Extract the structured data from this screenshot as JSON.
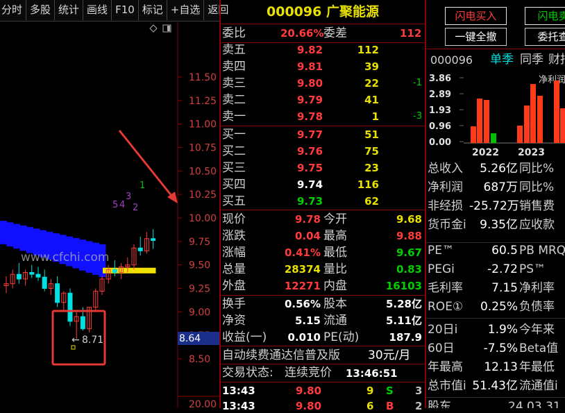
{
  "toolbar": {
    "items": [
      "分时",
      "多股",
      "统计",
      "画线",
      "F10",
      "标记",
      "+自选",
      "返回"
    ]
  },
  "chart": {
    "price_axis": [
      "11.50",
      "11.25",
      "11.00",
      "10.75",
      "10.50",
      "10.25",
      "10.00",
      "9.75",
      "9.50",
      "9.25",
      "9.00",
      "8.75",
      "8.50"
    ],
    "current_marker": "8.64",
    "bottom_axis": "20.00",
    "watermark": "www.cfchi.com",
    "low_label": "8.71",
    "wave_labels": [
      "5",
      "4",
      "3",
      "2",
      "1"
    ]
  },
  "quote": {
    "code": "000096",
    "name": "广聚能源",
    "committee_ratio_label": "委比",
    "committee_ratio": "20.66%",
    "committee_diff_label": "委差",
    "committee_diff": "112",
    "asks": [
      {
        "label": "卖五",
        "price": "9.82",
        "vol": "112",
        "chg": ""
      },
      {
        "label": "卖四",
        "price": "9.81",
        "vol": "39",
        "chg": ""
      },
      {
        "label": "卖三",
        "price": "9.80",
        "vol": "22",
        "chg": "-1"
      },
      {
        "label": "卖二",
        "price": "9.79",
        "vol": "41",
        "chg": ""
      },
      {
        "label": "卖一",
        "price": "9.78",
        "vol": "1",
        "chg": "-3"
      }
    ],
    "bids": [
      {
        "label": "买一",
        "price": "9.77",
        "vol": "51"
      },
      {
        "label": "买二",
        "price": "9.76",
        "vol": "75"
      },
      {
        "label": "买三",
        "price": "9.75",
        "vol": "23"
      },
      {
        "label": "买四",
        "price": "9.74",
        "vol": "116"
      },
      {
        "label": "买五",
        "price": "9.73",
        "vol": "62"
      }
    ],
    "stats": [
      {
        "l1": "现价",
        "v1": "9.78",
        "l2": "今开",
        "v2": "9.68"
      },
      {
        "l1": "涨跌",
        "v1": "0.04",
        "l2": "最高",
        "v2": "9.88"
      },
      {
        "l1": "涨幅",
        "v1": "0.41%",
        "l2": "最低",
        "v2": "9.67"
      },
      {
        "l1": "总量",
        "v1": "28374",
        "l2": "量比",
        "v2": "0.83"
      },
      {
        "l1": "外盘",
        "v1": "12271",
        "l2": "内盘",
        "v2": "16103"
      }
    ],
    "stats2": [
      {
        "l1": "换手",
        "v1": "0.56%",
        "l2": "股本",
        "v2": "5.28亿"
      },
      {
        "l1": "净资",
        "v1": "5.15",
        "l2": "流通",
        "v2": "5.11亿"
      },
      {
        "l1": "收益(一)",
        "v1": "0.010",
        "l2": "PE(动)",
        "v2": "187.9"
      }
    ],
    "ad_text": "自动续费通达信普及版",
    "ad_price": "30元/月",
    "trade_status_label": "交易状态:",
    "trade_status": "连续竞价",
    "trade_time": "13:46:51",
    "ticks": [
      {
        "time": "13:43",
        "price": "9.80",
        "vol": "9",
        "side": "S",
        "n": "3"
      },
      {
        "time": "13:43",
        "price": "9.80",
        "vol": "6",
        "side": "B",
        "n": "2"
      }
    ]
  },
  "side": {
    "flash_buy": "闪电买入",
    "flash_sell": "闪电卖",
    "cancel_all": "一键全撤",
    "entrust_query": "委托查",
    "code": "000096",
    "tab_single": "单季",
    "tab_yoy": "同季",
    "tab_finance": "财报",
    "chart_title": "净利润",
    "y_ticks": [
      "3.86",
      "2.89",
      "1.93",
      "0.96",
      "0.00"
    ],
    "years": [
      "2022",
      "2023"
    ],
    "fin": [
      {
        "l": "总收入",
        "v": "5.26亿",
        "r": "同比%"
      },
      {
        "l": "净利润",
        "v": "687万",
        "r": "同比%"
      },
      {
        "l": "非经损",
        "v": "-25.72万",
        "r": "销售费"
      },
      {
        "l": "货币金i",
        "v": "9.35亿",
        "r": "应收款"
      }
    ],
    "valuation": [
      {
        "l": "PE™",
        "v": "60.5",
        "r": "PB MRQ"
      },
      {
        "l": "PEGi",
        "v": "-2.72",
        "r": "PS™"
      },
      {
        "l": "毛利率",
        "v": "7.15",
        "r": "净利率"
      },
      {
        "l": "ROE①",
        "v": "0.25%",
        "r": "负债率"
      }
    ],
    "perf": [
      {
        "l": "20日i",
        "v": "1.9%",
        "r": "今年来"
      },
      {
        "l": "60日",
        "v": "-7.5%",
        "r": "Beta值"
      },
      {
        "l": "年最高",
        "v": "12.13",
        "r": "年最低"
      },
      {
        "l": "总市值i",
        "v": "51.43亿",
        "r": "流通值i"
      }
    ],
    "bottom_label": "股东",
    "bottom_value": "24.03.31"
  },
  "chart_data": {
    "type": "candlestick",
    "y_range": [
      8.4,
      11.7
    ],
    "candles": [
      [
        9.28,
        9.38,
        9.2,
        9.3
      ],
      [
        9.3,
        9.45,
        9.25,
        9.4
      ],
      [
        9.4,
        9.52,
        9.3,
        9.35
      ],
      [
        9.35,
        9.45,
        9.28,
        9.42
      ],
      [
        9.42,
        9.5,
        9.36,
        9.4
      ],
      [
        9.4,
        9.48,
        9.33,
        9.37
      ],
      [
        9.37,
        9.45,
        9.22,
        9.25
      ],
      [
        9.25,
        9.35,
        9.18,
        9.3
      ],
      [
        9.3,
        9.38,
        9.05,
        9.1
      ],
      [
        9.1,
        9.22,
        9.0,
        9.2
      ],
      [
        9.2,
        9.25,
        8.85,
        8.9
      ],
      [
        8.9,
        9.0,
        8.71,
        8.95
      ],
      [
        8.95,
        9.05,
        8.8,
        8.82
      ],
      [
        8.82,
        9.05,
        8.78,
        9.05
      ],
      [
        9.05,
        9.25,
        9.0,
        9.22
      ],
      [
        9.22,
        9.38,
        9.18,
        9.35
      ],
      [
        9.35,
        9.5,
        9.3,
        9.45
      ],
      [
        9.45,
        9.55,
        9.38,
        9.42
      ],
      [
        9.42,
        9.52,
        9.35,
        9.48
      ],
      [
        9.48,
        9.58,
        9.42,
        9.5
      ],
      [
        9.5,
        9.72,
        9.45,
        9.68
      ],
      [
        9.68,
        9.8,
        9.6,
        9.65
      ],
      [
        9.65,
        9.85,
        9.62,
        9.78
      ],
      [
        9.78,
        9.88,
        9.67,
        9.76
      ]
    ]
  }
}
